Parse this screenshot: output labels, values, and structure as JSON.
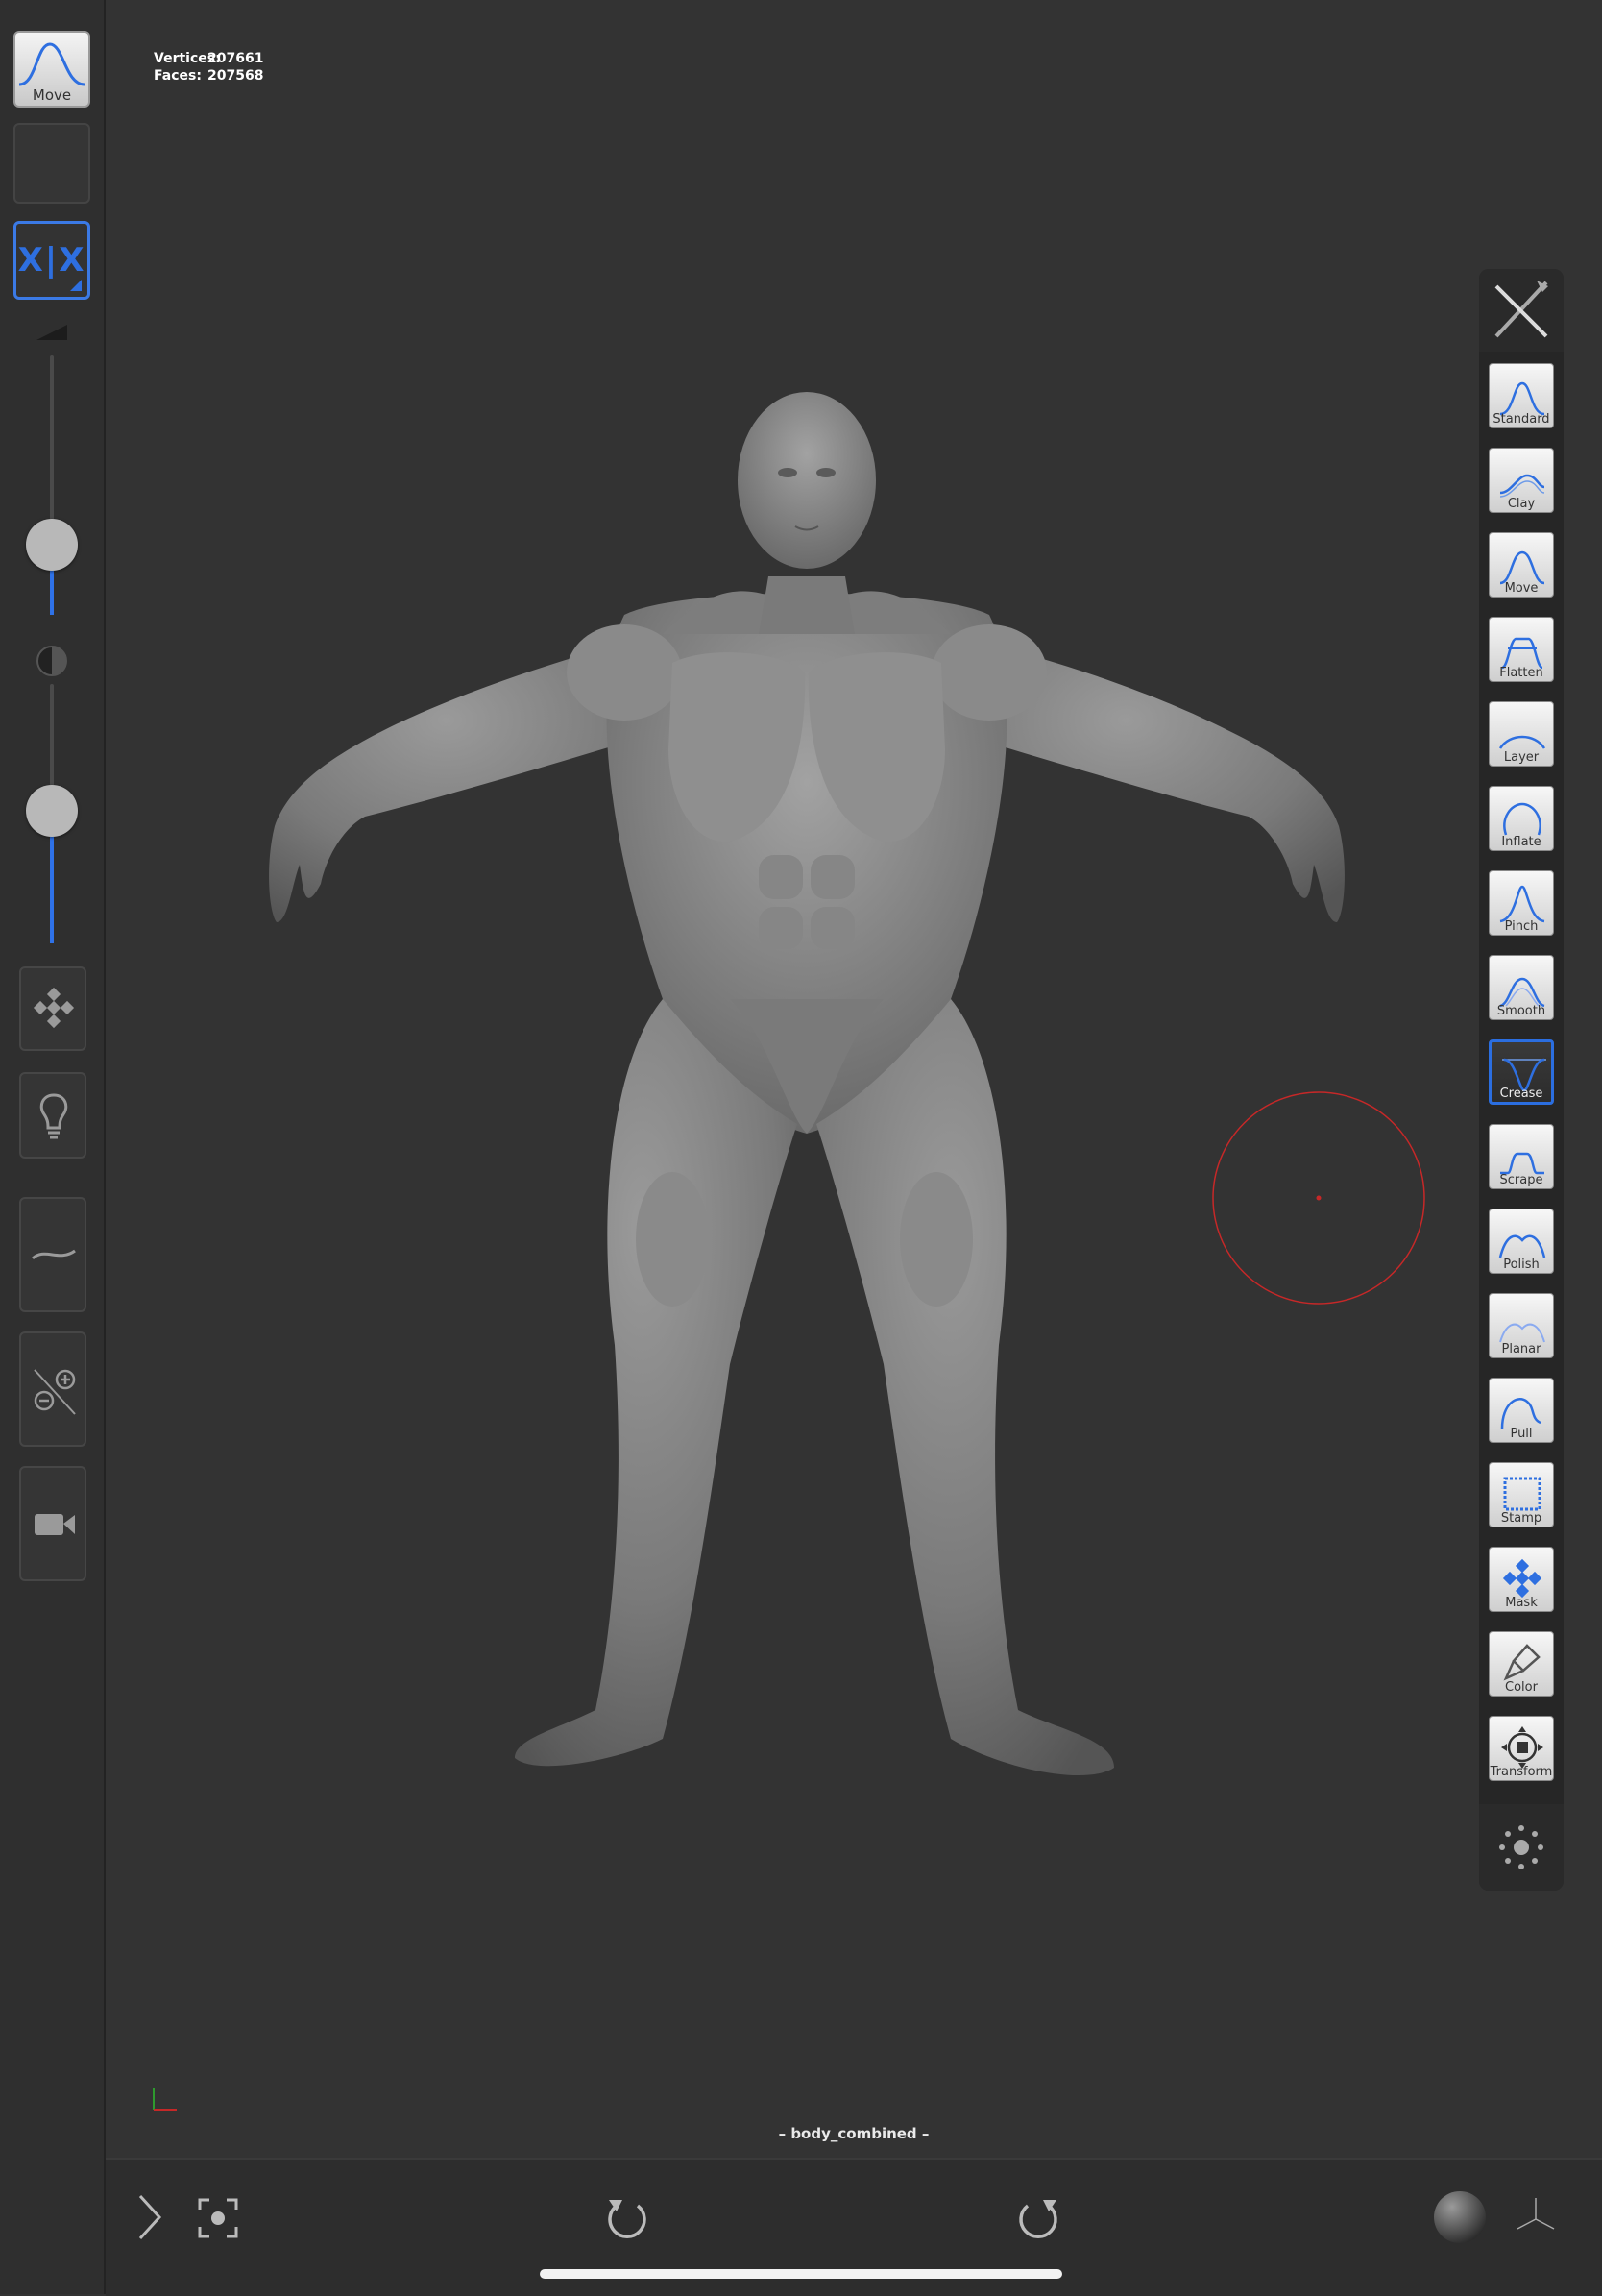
{
  "left_sidebar": {
    "current_tool_label": "Move",
    "symmetry_label": "X|X",
    "radius_slider_value": 0.3,
    "intensity_slider_value": 0.5
  },
  "stats": {
    "vertices_label": "Vertices:",
    "vertices_value": "207661",
    "faces_label": "Faces:",
    "faces_value": "207568"
  },
  "model_name": "– body_combined –",
  "tools": [
    {
      "label": "Standard",
      "icon": "standard-brush-icon"
    },
    {
      "label": "Clay",
      "icon": "clay-brush-icon"
    },
    {
      "label": "Move",
      "icon": "move-brush-icon"
    },
    {
      "label": "Flatten",
      "icon": "flatten-brush-icon"
    },
    {
      "label": "Layer",
      "icon": "layer-brush-icon"
    },
    {
      "label": "Inflate",
      "icon": "inflate-brush-icon"
    },
    {
      "label": "Pinch",
      "icon": "pinch-brush-icon"
    },
    {
      "label": "Smooth",
      "icon": "smooth-brush-icon"
    },
    {
      "label": "Crease",
      "icon": "crease-brush-icon",
      "active": true
    },
    {
      "label": "Scrape",
      "icon": "scrape-brush-icon"
    },
    {
      "label": "Polish",
      "icon": "polish-brush-icon"
    },
    {
      "label": "Planar",
      "icon": "planar-brush-icon"
    },
    {
      "label": "Pull",
      "icon": "pull-brush-icon"
    },
    {
      "label": "Stamp",
      "icon": "stamp-brush-icon"
    },
    {
      "label": "Mask",
      "icon": "mask-brush-icon"
    },
    {
      "label": "Color",
      "icon": "color-brush-icon"
    },
    {
      "label": "Transform",
      "icon": "transform-brush-icon"
    }
  ],
  "colors": {
    "accent": "#2f72e8",
    "background": "#333333",
    "brush_cursor": "#c62828"
  }
}
